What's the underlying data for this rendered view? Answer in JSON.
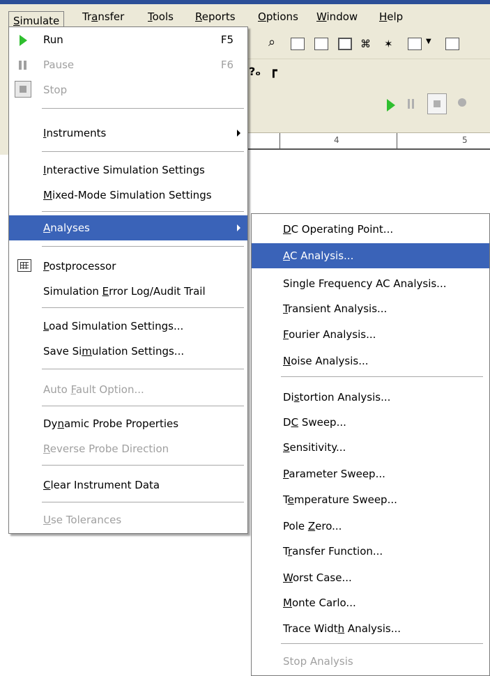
{
  "menubar": {
    "items": [
      {
        "label_pre": "",
        "mnemonic": "S",
        "label_post": "imulate"
      },
      {
        "label_pre": "Tr",
        "mnemonic": "a",
        "label_post": "nsfer"
      },
      {
        "label_pre": "",
        "mnemonic": "T",
        "label_post": "ools"
      },
      {
        "label_pre": "",
        "mnemonic": "R",
        "label_post": "eports"
      },
      {
        "label_pre": "",
        "mnemonic": "O",
        "label_post": "ptions"
      },
      {
        "label_pre": "",
        "mnemonic": "W",
        "label_post": "indow"
      },
      {
        "label_pre": "",
        "mnemonic": "H",
        "label_post": "elp"
      }
    ]
  },
  "ruler": {
    "labels": [
      "4",
      "5"
    ]
  },
  "simulate_menu": {
    "run": {
      "label": "Run",
      "accel": "F5",
      "icon": "play-icon"
    },
    "pause": {
      "label": "Pause",
      "accel": "F6",
      "icon": "pause-icon"
    },
    "stop": {
      "label": "Stop",
      "icon": "stop-icon"
    },
    "instruments": {
      "pre": "",
      "mn": "I",
      "post": "nstruments"
    },
    "interactive": {
      "pre": "",
      "mn": "I",
      "post": "nteractive Simulation Settings"
    },
    "mixed": {
      "pre": "",
      "mn": "M",
      "post": "ixed-Mode Simulation Settings"
    },
    "analyses": {
      "pre": "",
      "mn": "A",
      "post": "nalyses"
    },
    "postprocessor": {
      "pre": "",
      "mn": "P",
      "post": "ostprocessor",
      "icon": "postprocessor-icon"
    },
    "error_log": {
      "pre": "Simulation ",
      "mn": "E",
      "post": "rror Log/Audit Trail"
    },
    "load": {
      "pre": "",
      "mn": "L",
      "post": "oad Simulation Settings..."
    },
    "save": {
      "pre": "Save Si",
      "mn": "m",
      "post": "ulation Settings..."
    },
    "auto_fault": {
      "pre": "Auto ",
      "mn": "F",
      "post": "ault Option..."
    },
    "dynamic_probe": {
      "pre": "Dy",
      "mn": "n",
      "post": "amic Probe Properties"
    },
    "reverse_probe": {
      "pre": "",
      "mn": "R",
      "post": "everse Probe Direction"
    },
    "clear": {
      "pre": "",
      "mn": "C",
      "post": "lear Instrument Data"
    },
    "tolerances": {
      "pre": "",
      "mn": "U",
      "post": "se Tolerances"
    }
  },
  "analyses_submenu": [
    {
      "pre": "",
      "mn": "D",
      "post": "C Operating Point..."
    },
    {
      "pre": "",
      "mn": "A",
      "post": "C Analysis..."
    },
    {
      "pre": "Single Frequency AC Analysis...",
      "mn": "",
      "post": ""
    },
    {
      "pre": "",
      "mn": "T",
      "post": "ransient Analysis..."
    },
    {
      "pre": "",
      "mn": "F",
      "post": "ourier Analysis..."
    },
    {
      "pre": "",
      "mn": "N",
      "post": "oise Analysis..."
    },
    {
      "pre": "Di",
      "mn": "s",
      "post": "tortion Analysis..."
    },
    {
      "pre": "D",
      "mn": "C",
      "post": " Sweep..."
    },
    {
      "pre": "",
      "mn": "S",
      "post": "ensitivity..."
    },
    {
      "pre": "",
      "mn": "P",
      "post": "arameter Sweep..."
    },
    {
      "pre": "T",
      "mn": "e",
      "post": "mperature Sweep..."
    },
    {
      "pre": "Pole ",
      "mn": "Z",
      "post": "ero..."
    },
    {
      "pre": "T",
      "mn": "r",
      "post": "ansfer Function..."
    },
    {
      "pre": "",
      "mn": "W",
      "post": "orst Case..."
    },
    {
      "pre": "",
      "mn": "M",
      "post": "onte Carlo..."
    },
    {
      "pre": "Trace Widt",
      "mn": "h",
      "post": " Analysis..."
    },
    {
      "pre": "Stop Analysis",
      "mn": "",
      "post": ""
    }
  ],
  "colors": {
    "highlight": "#3a63b8",
    "disabled_text": "#a0a0a0",
    "menu_bg": "#ffffff",
    "bar_bg": "#ece9d8",
    "play_green": "#2fbf2f"
  }
}
